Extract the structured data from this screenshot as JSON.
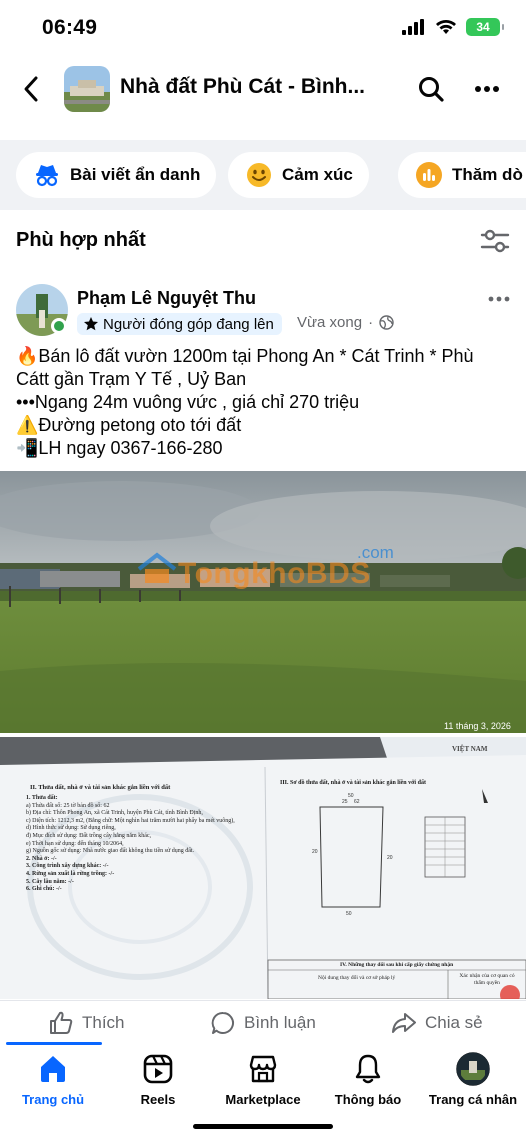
{
  "status": {
    "time": "06:49",
    "battery": "34"
  },
  "header": {
    "title": "Nhà đất Phù Cát - Bình..."
  },
  "chips": [
    {
      "label": "Bài viết ẩn danh",
      "icon": "anonymous-icon"
    },
    {
      "label": "Cảm xúc",
      "icon": "smiley-icon"
    },
    {
      "label": "Thăm dò ý",
      "icon": "poll-icon"
    }
  ],
  "section": {
    "title": "Phù hợp nhất"
  },
  "post": {
    "author": "Phạm Lê Nguyệt Thu",
    "badge": "Người đóng góp đang lên",
    "time": "Vừa xong",
    "separator": "·",
    "lines": [
      "🔥Bán lô đất vườn 1200m tại Phong An * Cát Trinh * Phù",
      "Cátt gần Trạm Y Tế , Uỷ Ban",
      "•••Ngang 24m vuông vức , giá chỉ 270 triệu",
      "⚠️Đường petong oto tới đất",
      "📲LH ngay 0367-166-280"
    ],
    "photo1": {
      "watermark_main": "TongkhoBDS",
      "watermark_suffix": ".com",
      "date": "11 tháng 3, 2026"
    },
    "photo2": {
      "left_heading": "II. Thửa đất, nhà ở và tài sản khác gắn liền với đất",
      "left_lines": [
        "1. Thửa đất:",
        "a) Thửa đất số: 25     tờ bản đồ số: 62",
        "b) Địa chỉ: Thôn Phong An, xã Cát Trinh, huyện Phù Cát, tỉnh Bình Định,",
        "c) Diện tích: 1212,3 m2, (Bằng chữ: Một nghìn hai trăm mười hai phẩy ba mét vuông),",
        "d) Hình thức sử dụng: Sử dụng riêng,",
        "đ) Mục đích sử dụng: Đất trồng cây hằng năm khác,",
        "e) Thời hạn sử dụng: đến tháng 10/2064,",
        "g) Nguồn gốc sử dụng: Nhà nước giao đất không thu tiền sử dụng đất.",
        "2. Nhà ở: -/-",
        "3. Công trình xây dựng khác: -/-",
        "4. Rừng sản xuất là rừng trồng: -/-",
        "5. Cây lâu năm: -/-",
        "6. Ghi chú: -/-"
      ],
      "right_heading": "III. Sơ đồ thửa đất, nhà ở và tài sản khác gắn liền với đất",
      "changes_heading": "IV. Những thay đổi sau khi cấp giấy chứng nhận",
      "changes_col1": "Nội dung thay đổi và cơ sở pháp lý",
      "changes_col2": "Xác nhận của cơ quan có thẩm quyền",
      "plan_labels": [
        "25",
        "62",
        "20",
        "20",
        "50",
        "50"
      ],
      "stamp_text": "VIỆT NAM"
    }
  },
  "actions": {
    "like": "Thích",
    "comment": "Bình luận",
    "share": "Chia sẻ"
  },
  "tabs": [
    {
      "label": "Trang chủ",
      "icon": "home-icon",
      "active": true
    },
    {
      "label": "Reels",
      "icon": "reels-icon",
      "active": false
    },
    {
      "label": "Marketplace",
      "icon": "marketplace-icon",
      "active": false
    },
    {
      "label": "Thông báo",
      "icon": "bell-icon",
      "active": false
    },
    {
      "label": "Trang cá nhân",
      "icon": "profile-avatar-icon",
      "active": false
    }
  ],
  "colors": {
    "accent": "#0866ff",
    "online": "#31a24c",
    "battery": "#34c759"
  }
}
